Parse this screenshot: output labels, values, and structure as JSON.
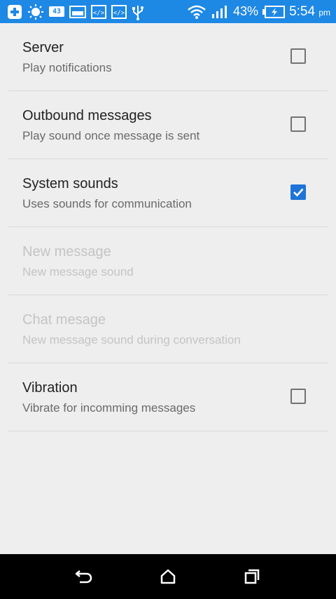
{
  "status_bar": {
    "badge_text": "43",
    "battery_percent": "43%",
    "time": "5:54",
    "time_suffix": "pm",
    "icons": [
      "add-icon",
      "weather-icon",
      "badge-icon",
      "image-icon",
      "code-icon",
      "code-icon",
      "usb-icon",
      "wifi-icon",
      "signal-icon",
      "battery-charging-icon"
    ]
  },
  "settings": [
    {
      "title": "Server",
      "summary": "Play notifications",
      "checked": false,
      "enabled": true
    },
    {
      "title": "Outbound messages",
      "summary": "Play sound once message is sent",
      "checked": false,
      "enabled": true
    },
    {
      "title": "System sounds",
      "summary": "Uses sounds for communication",
      "checked": true,
      "enabled": true
    },
    {
      "title": "New message",
      "summary": "New message sound",
      "enabled": false
    },
    {
      "title": "Chat mesage",
      "summary": "New message sound during conversation",
      "enabled": false
    },
    {
      "title": "Vibration",
      "summary": "Vibrate for incomming messages",
      "checked": false,
      "enabled": true
    }
  ],
  "nav_bar": {
    "icons": [
      "back-icon",
      "home-icon",
      "recents-icon"
    ]
  },
  "colors": {
    "accent": "#1e74d8",
    "status_bar": "#1e88e5",
    "background": "#eeeeee"
  }
}
